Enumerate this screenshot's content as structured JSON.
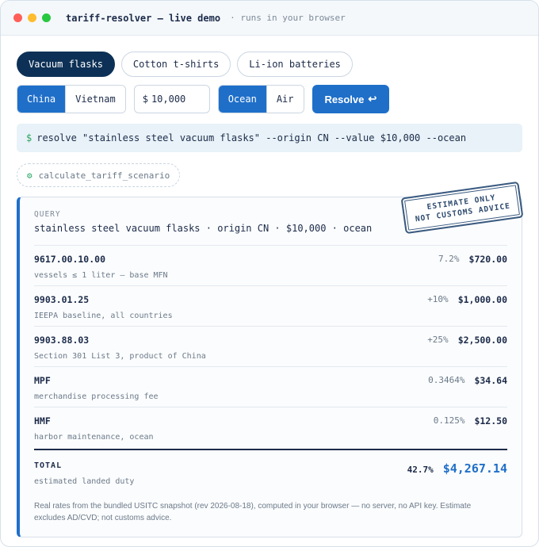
{
  "window": {
    "title": "tariff-resolver — live demo",
    "subtitle": "· runs in your browser"
  },
  "presets": [
    "Vacuum flasks",
    "Cotton t-shirts",
    "Li-ion batteries"
  ],
  "controls": {
    "origins": [
      "China",
      "Vietnam"
    ],
    "value_currency": "$",
    "value": "10,000",
    "modes": [
      "Ocean",
      "Air"
    ],
    "resolve_label": "Resolve",
    "resolve_icon": "↩"
  },
  "command": {
    "prompt": "$",
    "text": "resolve \"stainless steel vacuum flasks\" --origin CN --value $10,000 --ocean"
  },
  "tool_call": {
    "icon": "gear-icon",
    "name": "calculate_tariff_scenario"
  },
  "result": {
    "stamp_line1": "ESTIMATE ONLY",
    "stamp_line2": "NOT CUSTOMS ADVICE",
    "query_label": "QUERY",
    "query_text": "stainless steel vacuum flasks · origin CN · $10,000 · ocean",
    "lines": [
      {
        "code": "9617.00.10.00",
        "desc": "vessels ≤ 1 liter — base MFN",
        "rate": "7.2%",
        "amount": "$720.00"
      },
      {
        "code": "9903.01.25",
        "desc": "IEEPA baseline, all countries",
        "rate": "+10%",
        "amount": "$1,000.00"
      },
      {
        "code": "9903.88.03",
        "desc": "Section 301 List 3, product of China",
        "rate": "+25%",
        "amount": "$2,500.00"
      },
      {
        "code": "MPF",
        "desc": "merchandise processing fee",
        "rate": "0.3464%",
        "amount": "$34.64"
      },
      {
        "code": "HMF",
        "desc": "harbor maintenance, ocean",
        "rate": "0.125%",
        "amount": "$12.50"
      }
    ],
    "total": {
      "label": "TOTAL",
      "desc": "estimated landed duty",
      "rate": "42.7%",
      "amount": "$4,267.14"
    },
    "footnote": "Real rates from the bundled USITC snapshot (rev 2026-08-18), computed in your browser — no server, no API key. Estimate excludes AD/CVD; not customs advice."
  }
}
